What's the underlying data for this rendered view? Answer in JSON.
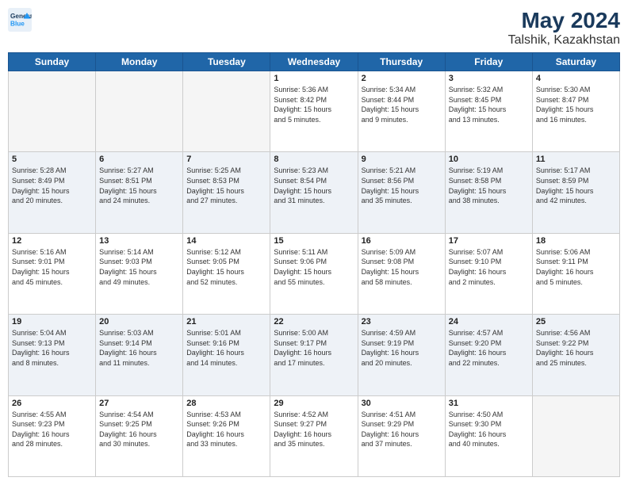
{
  "header": {
    "logo_line1": "General",
    "logo_line2": "Blue",
    "main_title": "May 2024",
    "subtitle": "Talshik, Kazakhstan"
  },
  "days_of_week": [
    "Sunday",
    "Monday",
    "Tuesday",
    "Wednesday",
    "Thursday",
    "Friday",
    "Saturday"
  ],
  "weeks": [
    [
      {
        "num": "",
        "info": ""
      },
      {
        "num": "",
        "info": ""
      },
      {
        "num": "",
        "info": ""
      },
      {
        "num": "1",
        "info": "Sunrise: 5:36 AM\nSunset: 8:42 PM\nDaylight: 15 hours\nand 5 minutes."
      },
      {
        "num": "2",
        "info": "Sunrise: 5:34 AM\nSunset: 8:44 PM\nDaylight: 15 hours\nand 9 minutes."
      },
      {
        "num": "3",
        "info": "Sunrise: 5:32 AM\nSunset: 8:45 PM\nDaylight: 15 hours\nand 13 minutes."
      },
      {
        "num": "4",
        "info": "Sunrise: 5:30 AM\nSunset: 8:47 PM\nDaylight: 15 hours\nand 16 minutes."
      }
    ],
    [
      {
        "num": "5",
        "info": "Sunrise: 5:28 AM\nSunset: 8:49 PM\nDaylight: 15 hours\nand 20 minutes."
      },
      {
        "num": "6",
        "info": "Sunrise: 5:27 AM\nSunset: 8:51 PM\nDaylight: 15 hours\nand 24 minutes."
      },
      {
        "num": "7",
        "info": "Sunrise: 5:25 AM\nSunset: 8:53 PM\nDaylight: 15 hours\nand 27 minutes."
      },
      {
        "num": "8",
        "info": "Sunrise: 5:23 AM\nSunset: 8:54 PM\nDaylight: 15 hours\nand 31 minutes."
      },
      {
        "num": "9",
        "info": "Sunrise: 5:21 AM\nSunset: 8:56 PM\nDaylight: 15 hours\nand 35 minutes."
      },
      {
        "num": "10",
        "info": "Sunrise: 5:19 AM\nSunset: 8:58 PM\nDaylight: 15 hours\nand 38 minutes."
      },
      {
        "num": "11",
        "info": "Sunrise: 5:17 AM\nSunset: 8:59 PM\nDaylight: 15 hours\nand 42 minutes."
      }
    ],
    [
      {
        "num": "12",
        "info": "Sunrise: 5:16 AM\nSunset: 9:01 PM\nDaylight: 15 hours\nand 45 minutes."
      },
      {
        "num": "13",
        "info": "Sunrise: 5:14 AM\nSunset: 9:03 PM\nDaylight: 15 hours\nand 49 minutes."
      },
      {
        "num": "14",
        "info": "Sunrise: 5:12 AM\nSunset: 9:05 PM\nDaylight: 15 hours\nand 52 minutes."
      },
      {
        "num": "15",
        "info": "Sunrise: 5:11 AM\nSunset: 9:06 PM\nDaylight: 15 hours\nand 55 minutes."
      },
      {
        "num": "16",
        "info": "Sunrise: 5:09 AM\nSunset: 9:08 PM\nDaylight: 15 hours\nand 58 minutes."
      },
      {
        "num": "17",
        "info": "Sunrise: 5:07 AM\nSunset: 9:10 PM\nDaylight: 16 hours\nand 2 minutes."
      },
      {
        "num": "18",
        "info": "Sunrise: 5:06 AM\nSunset: 9:11 PM\nDaylight: 16 hours\nand 5 minutes."
      }
    ],
    [
      {
        "num": "19",
        "info": "Sunrise: 5:04 AM\nSunset: 9:13 PM\nDaylight: 16 hours\nand 8 minutes."
      },
      {
        "num": "20",
        "info": "Sunrise: 5:03 AM\nSunset: 9:14 PM\nDaylight: 16 hours\nand 11 minutes."
      },
      {
        "num": "21",
        "info": "Sunrise: 5:01 AM\nSunset: 9:16 PM\nDaylight: 16 hours\nand 14 minutes."
      },
      {
        "num": "22",
        "info": "Sunrise: 5:00 AM\nSunset: 9:17 PM\nDaylight: 16 hours\nand 17 minutes."
      },
      {
        "num": "23",
        "info": "Sunrise: 4:59 AM\nSunset: 9:19 PM\nDaylight: 16 hours\nand 20 minutes."
      },
      {
        "num": "24",
        "info": "Sunrise: 4:57 AM\nSunset: 9:20 PM\nDaylight: 16 hours\nand 22 minutes."
      },
      {
        "num": "25",
        "info": "Sunrise: 4:56 AM\nSunset: 9:22 PM\nDaylight: 16 hours\nand 25 minutes."
      }
    ],
    [
      {
        "num": "26",
        "info": "Sunrise: 4:55 AM\nSunset: 9:23 PM\nDaylight: 16 hours\nand 28 minutes."
      },
      {
        "num": "27",
        "info": "Sunrise: 4:54 AM\nSunset: 9:25 PM\nDaylight: 16 hours\nand 30 minutes."
      },
      {
        "num": "28",
        "info": "Sunrise: 4:53 AM\nSunset: 9:26 PM\nDaylight: 16 hours\nand 33 minutes."
      },
      {
        "num": "29",
        "info": "Sunrise: 4:52 AM\nSunset: 9:27 PM\nDaylight: 16 hours\nand 35 minutes."
      },
      {
        "num": "30",
        "info": "Sunrise: 4:51 AM\nSunset: 9:29 PM\nDaylight: 16 hours\nand 37 minutes."
      },
      {
        "num": "31",
        "info": "Sunrise: 4:50 AM\nSunset: 9:30 PM\nDaylight: 16 hours\nand 40 minutes."
      },
      {
        "num": "",
        "info": ""
      }
    ]
  ]
}
